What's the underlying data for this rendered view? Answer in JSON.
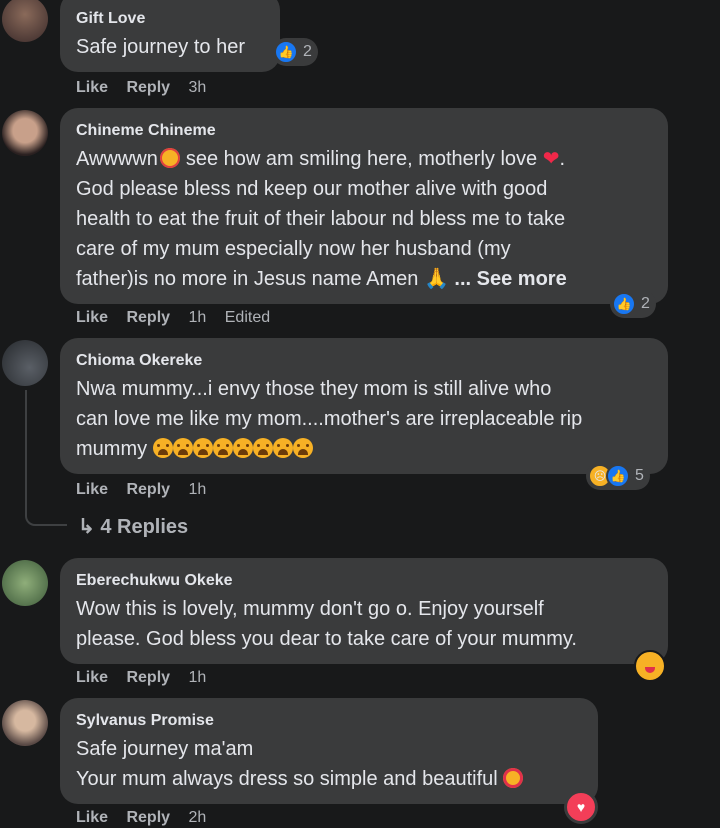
{
  "actions": {
    "like": "Like",
    "reply": "Reply"
  },
  "comments": [
    {
      "author": "Gift Love",
      "lines": [
        "Safe journey to her"
      ],
      "time": "3h",
      "reaction_count": "2",
      "reactions": [
        "like"
      ]
    },
    {
      "author": "Chineme Chineme",
      "lines": [
        "Awwwwn",
        "see how am smiling here, motherly love",
        ".",
        "God please bless nd keep our mother alive with good",
        "health to eat the fruit of their labour nd bless me to take",
        "care of my mum especially now her husband (my",
        "father)is no more in Jesus name Amen",
        "... See more"
      ],
      "time": "1h",
      "edited": "Edited",
      "reaction_count": "2",
      "reactions": [
        "like"
      ]
    },
    {
      "author": "Chioma Okereke",
      "lines": [
        "Nwa mummy...i envy those they mom is still alive who",
        "can love me like my mom....mother's are irreplaceable rip",
        "mummy"
      ],
      "time": "1h",
      "reaction_count": "5",
      "reactions": [
        "sad",
        "like"
      ],
      "replies_label": "4 Replies",
      "replies_arrow": "↳"
    },
    {
      "author": "Eberechukwu Okeke",
      "lines": [
        "Wow this is lovely, mummy don't go o. Enjoy yourself",
        "please. God bless you dear to take care of your mummy."
      ],
      "time": "1h",
      "reactions": [
        "yum"
      ]
    },
    {
      "author": "Sylvanus Promise",
      "lines": [
        "Safe journey ma'am",
        "Your mum always dress so simple and beautiful"
      ],
      "time": "2h",
      "reactions": [
        "love"
      ]
    }
  ],
  "icons": {
    "like": "like-reaction-icon",
    "sad": "sad-reaction-icon",
    "love": "love-reaction-icon",
    "yum": "yum-emoji-icon"
  },
  "colors": {
    "background": "#18191a",
    "bubble": "#3a3b3c",
    "like_blue": "#1877f2",
    "text": "#e4e6eb",
    "muted": "#b0b3b8"
  }
}
